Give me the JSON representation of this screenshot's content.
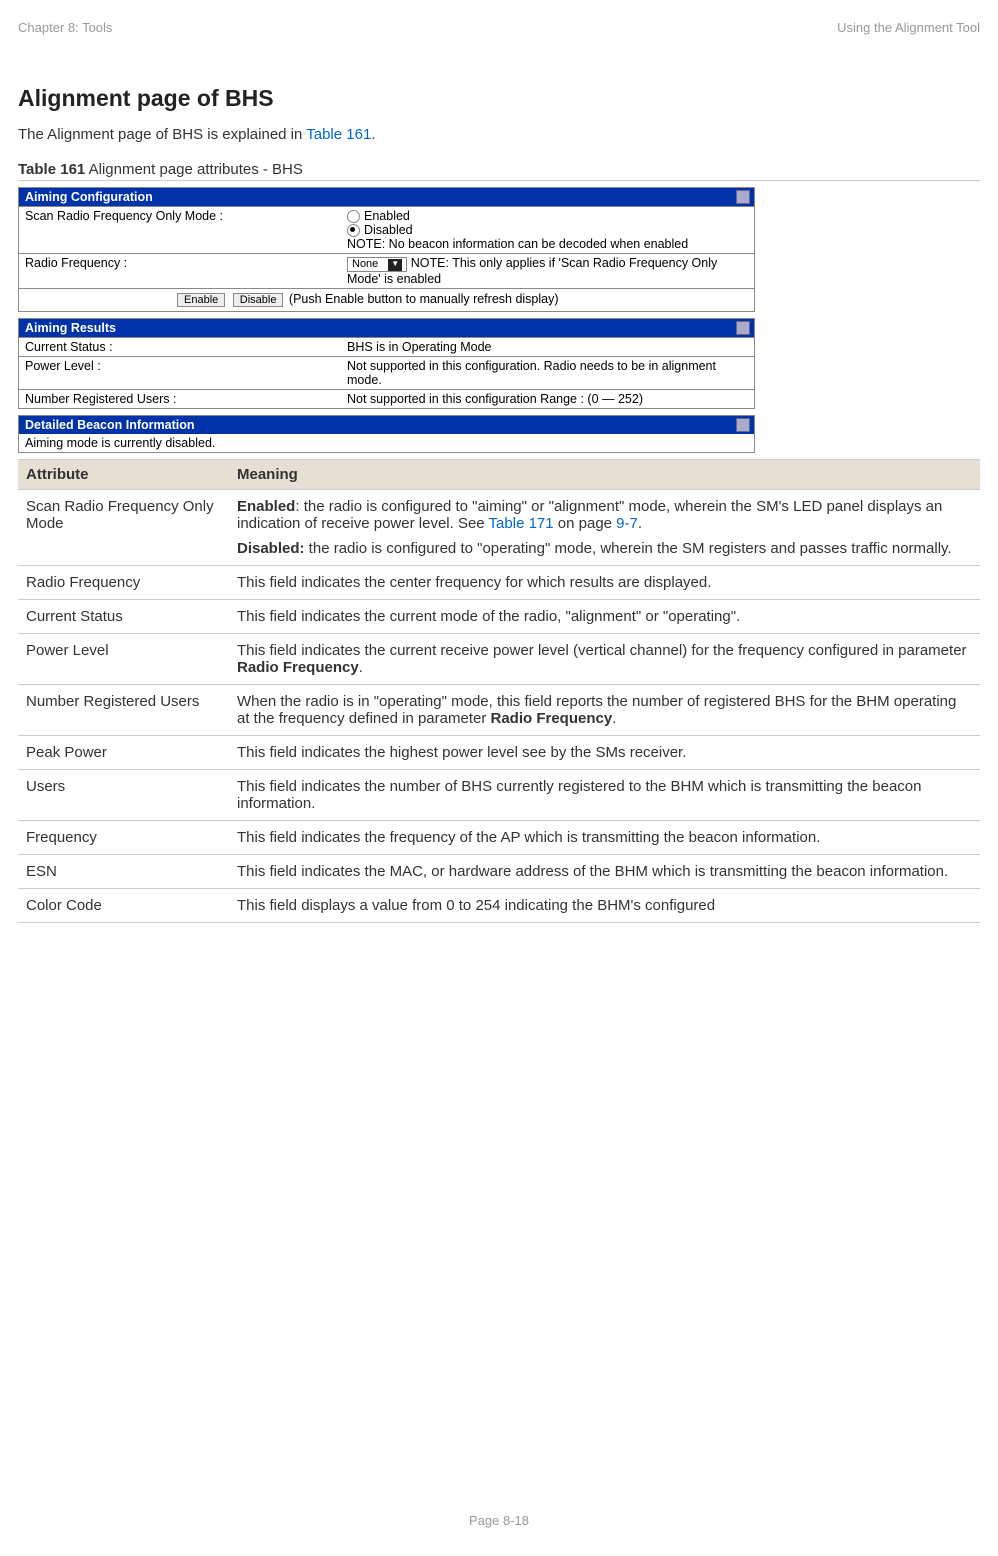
{
  "header": {
    "left": "Chapter 8:  Tools",
    "right": "Using the Alignment Tool"
  },
  "section_title": "Alignment page of BHS",
  "intro_pre": "The Alignment page of BHS is explained in ",
  "intro_link": "Table 161",
  "intro_post": ".",
  "table_caption_bold": "Table 161",
  "table_caption_rest": " Alignment page attributes - BHS",
  "panels": {
    "config": {
      "title": "Aiming Configuration",
      "row1_label": "Scan Radio Frequency Only Mode :",
      "row1_opt1": "Enabled",
      "row1_opt2": "Disabled",
      "row1_note": "NOTE: No beacon information can be decoded when enabled",
      "row2_label": "Radio Frequency :",
      "row2_select": "None",
      "row2_note": "NOTE: This only applies if 'Scan Radio Frequency Only Mode' is enabled",
      "enable_btn1": "Enable",
      "enable_btn2": "Disable",
      "enable_note": "(Push Enable button to manually refresh display)"
    },
    "results": {
      "title": "Aiming Results",
      "rows": [
        {
          "label": "Current Status :",
          "value": "BHS is in Operating Mode"
        },
        {
          "label": "Power Level :",
          "value": "Not supported in this configuration. Radio needs to be in alignment mode."
        },
        {
          "label": "Number Registered Users :",
          "value": "Not supported in this configuration Range : (0 — 252)"
        }
      ]
    },
    "beacon": {
      "title": "Detailed Beacon Information",
      "note": "Aiming mode is currently disabled."
    }
  },
  "attr_table": {
    "head": {
      "c1": "Attribute",
      "c2": "Meaning"
    },
    "rows": [
      {
        "attr": "Scan Radio Frequency Only Mode",
        "p1_b": "Enabled",
        "p1": ": the radio is configured to \"aiming\" or \"alignment\" mode, wherein the SM's LED panel displays an indication of receive power level. See ",
        "p1_link1": "Table 171",
        "p1_mid": " on page ",
        "p1_link2": "9-7",
        "p1_end": ".",
        "p2_b": "Disabled:",
        "p2": " the radio is configured to \"operating\" mode, wherein the SM registers and passes traffic normally."
      },
      {
        "attr": "Radio Frequency",
        "p1": "This field indicates the center frequency for which results are displayed."
      },
      {
        "attr": "Current Status",
        "p1": "This field indicates the current mode of the radio, \"alignment\" or \"operating\"."
      },
      {
        "attr": "Power Level",
        "p1": "This field indicates the current receive power level (vertical channel) for the frequency configured in parameter ",
        "p1_b2": "Radio Frequency",
        "p1_end": "."
      },
      {
        "attr": "Number Registered Users",
        "p1": "When the radio is in \"operating\" mode, this field reports the number of registered BHS for the BHM operating at the frequency defined in parameter ",
        "p1_b2": "Radio Frequency",
        "p1_end": "."
      },
      {
        "attr": "Peak Power",
        "p1": "This field indicates the highest power level see by the SMs receiver."
      },
      {
        "attr": "Users",
        "p1": "This field indicates the number of BHS currently registered to the BHM which is transmitting the beacon information."
      },
      {
        "attr": "Frequency",
        "p1": "This field indicates the frequency of the AP which is transmitting the beacon information."
      },
      {
        "attr": "ESN",
        "p1": "This field indicates the MAC, or hardware address of the BHM which is transmitting the beacon information."
      },
      {
        "attr": "Color Code",
        "p1": "This field displays a value from 0 to 254 indicating the BHM's configured"
      }
    ]
  },
  "footer": "Page 8-18"
}
